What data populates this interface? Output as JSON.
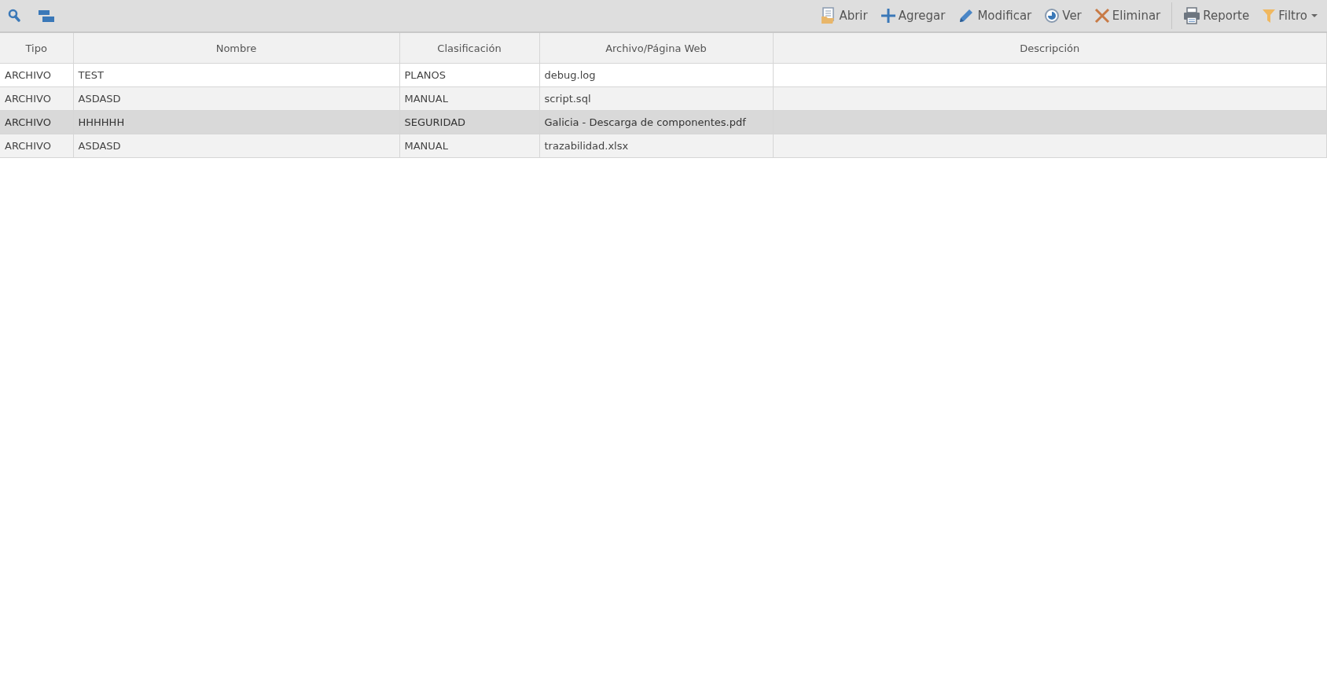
{
  "toolbar": {
    "left_tools": [
      {
        "kind": "search"
      },
      {
        "kind": "panels"
      }
    ],
    "actions": [
      {
        "kind": "open",
        "label": "Abrir"
      },
      {
        "kind": "add",
        "label": "Agregar"
      },
      {
        "kind": "edit",
        "label": "Modificar"
      },
      {
        "kind": "view",
        "label": "Ver"
      },
      {
        "kind": "delete",
        "label": "Eliminar"
      },
      {
        "kind": "report",
        "label": "Reporte"
      },
      {
        "kind": "filter",
        "label": "Filtro"
      }
    ]
  },
  "table": {
    "columns": [
      "Tipo",
      "Nombre",
      "Clasificación",
      "Archivo/Página Web",
      "Descripción"
    ],
    "rows": [
      {
        "selected": false,
        "cells": [
          "ARCHIVO",
          "TEST",
          "PLANOS",
          "debug.log"
        ]
      },
      {
        "selected": false,
        "cells": [
          "ARCHIVO",
          "ASDASD",
          "MANUAL",
          "script.sql"
        ]
      },
      {
        "selected": true,
        "cells": [
          "ARCHIVO",
          "HHHHHH",
          "SEGURIDAD",
          "Galicia - Descarga de componentes.pdf"
        ]
      },
      {
        "selected": false,
        "cells": [
          "ARCHIVO",
          "ASDASD",
          "MANUAL",
          "trazabilidad.xlsx"
        ]
      }
    ]
  }
}
